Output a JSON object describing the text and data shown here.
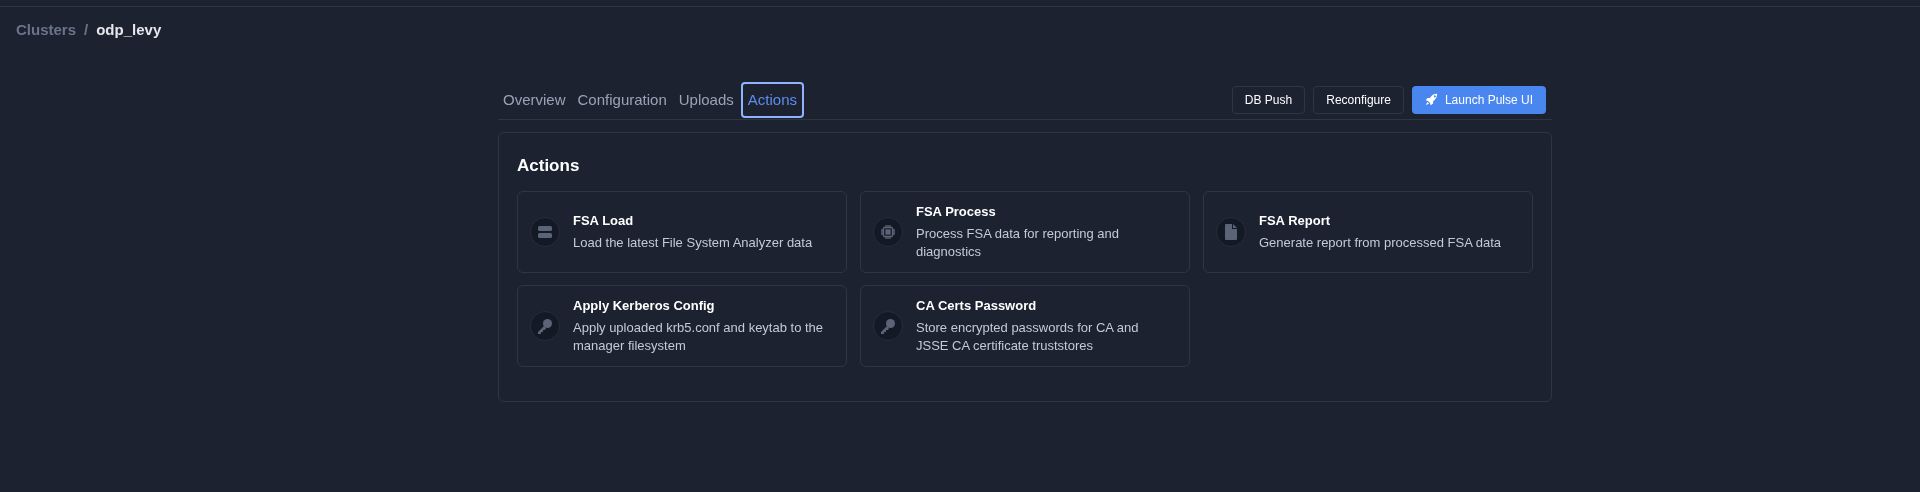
{
  "breadcrumb": [
    {
      "label": "Clusters",
      "current": false
    },
    {
      "label": "/",
      "current": false
    },
    {
      "label": "odp_levy",
      "current": true
    }
  ],
  "tabs": [
    {
      "label": "Overview",
      "selected": false
    },
    {
      "label": "Configuration",
      "selected": false
    },
    {
      "label": "Uploads",
      "selected": false
    },
    {
      "label": "Actions",
      "selected": true
    }
  ],
  "buttons": [
    {
      "label": "DB Push",
      "kind": "outline"
    },
    {
      "label": "Reconfigure",
      "kind": "outline"
    },
    {
      "label": "Launch Pulse UI",
      "kind": "primary"
    }
  ],
  "panel": {
    "title": "Actions",
    "cards": [
      {
        "title": "FSA Load",
        "description": "Load the latest File System Analyzer data"
      },
      {
        "title": "FSA Process",
        "description": "Process FSA data for reporting and diagnostics"
      },
      {
        "title": "FSA Report",
        "description": "Generate report from processed FSA data"
      },
      {
        "title": "Apply Kerberos Config",
        "description": "Apply uploaded krb5.conf and keytab to the manager filesystem"
      },
      {
        "title": "CA Certs Password",
        "description": "Store encrypted passwords for CA and JSSE CA certificate truststores"
      }
    ]
  }
}
